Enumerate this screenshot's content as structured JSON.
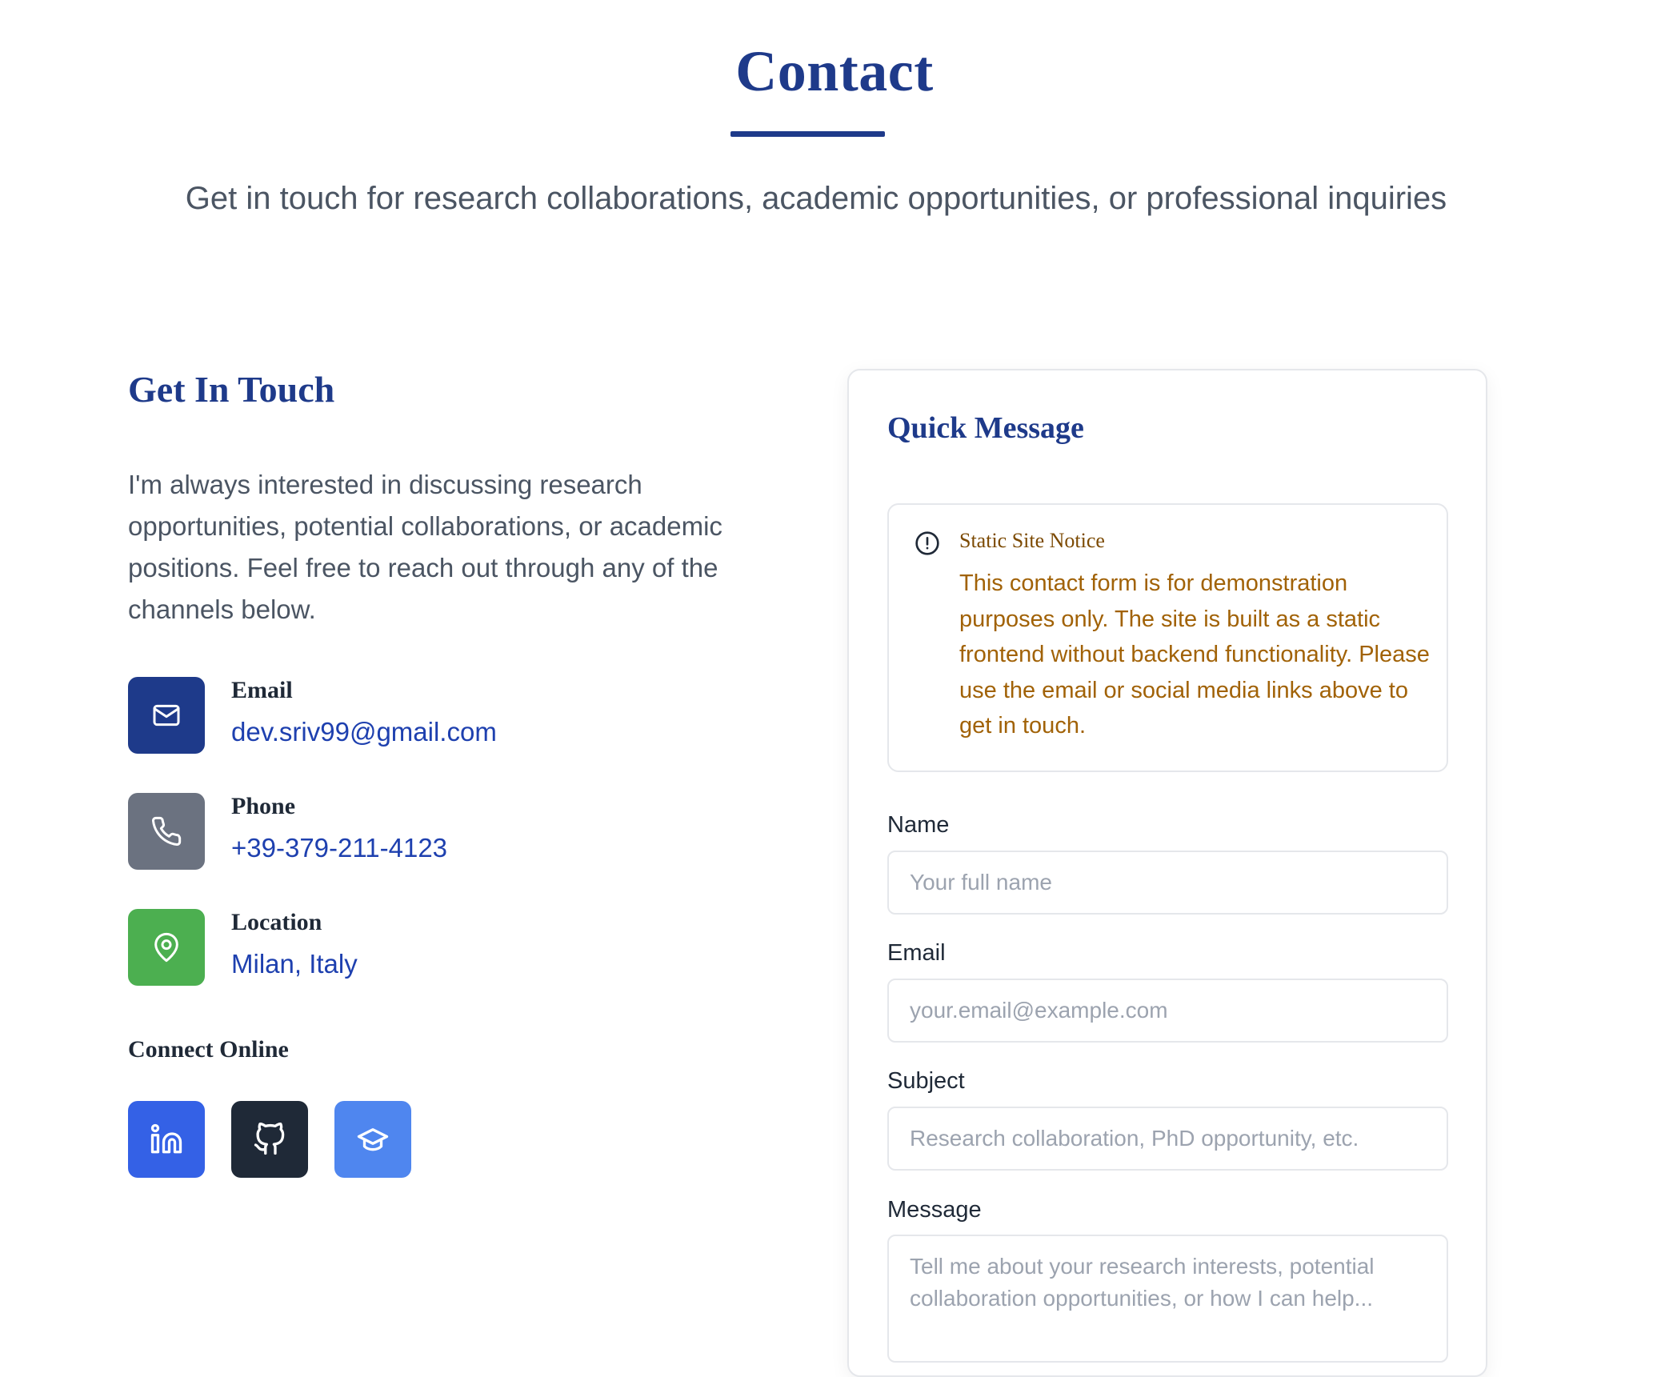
{
  "header": {
    "title": "Contact",
    "subtitle": "Get in touch for research collaborations, academic opportunities, or professional inquiries"
  },
  "get_in_touch": {
    "title": "Get In Touch",
    "intro": "I'm always interested in discussing research opportunities, potential collaborations, or academic positions. Feel free to reach out through any of the channels below.",
    "items": [
      {
        "label": "Email",
        "value": "dev.sriv99@gmail.com",
        "icon": "mail-icon",
        "color": "#1e3a8a"
      },
      {
        "label": "Phone",
        "value": "+39-379-211-4123",
        "icon": "phone-icon",
        "color": "#6b7280"
      },
      {
        "label": "Location",
        "value": "Milan, Italy",
        "icon": "map-pin-icon",
        "color": "#4caf50"
      }
    ],
    "connect_title": "Connect Online",
    "social": [
      {
        "icon": "linkedin-icon",
        "color": "#3461e6"
      },
      {
        "icon": "github-icon",
        "color": "#1f2937"
      },
      {
        "icon": "graduation-cap-icon",
        "color": "#4f86ef"
      }
    ]
  },
  "quick_message": {
    "title": "Quick Message",
    "notice": {
      "title": "Static Site Notice",
      "body": "This contact form is for demonstration purposes only. The site is built as a static frontend without backend functionality. Please use the email or social media links above to get in touch."
    },
    "fields": {
      "name": {
        "label": "Name",
        "placeholder": "Your full name"
      },
      "email": {
        "label": "Email",
        "placeholder": "your.email@example.com"
      },
      "subject": {
        "label": "Subject",
        "placeholder": "Research collaboration, PhD opportunity, etc."
      },
      "message": {
        "label": "Message",
        "placeholder": "Tell me about your research interests, potential collaboration opportunities, or how I can help..."
      }
    }
  },
  "colors": {
    "primary": "#1e3a8a",
    "link": "#1e40af",
    "notice_text": "#a16207"
  }
}
